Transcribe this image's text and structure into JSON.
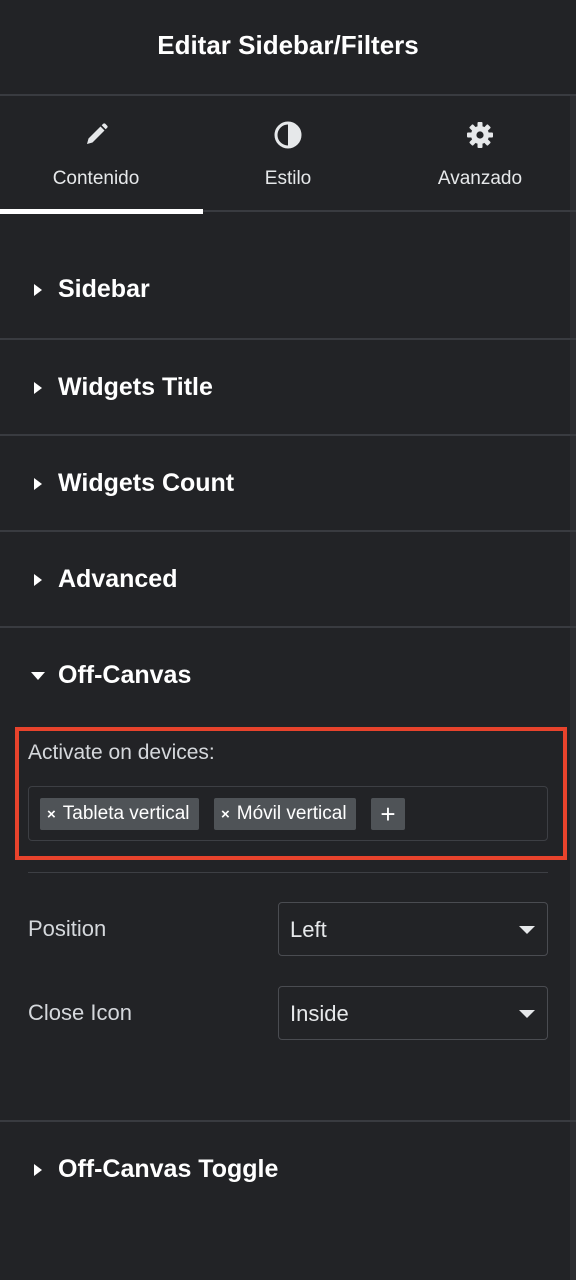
{
  "header": {
    "title": "Editar Sidebar/Filters"
  },
  "tabs": [
    {
      "label": "Contenido",
      "icon": "pencil-icon",
      "active": true
    },
    {
      "label": "Estilo",
      "icon": "contrast-icon",
      "active": false
    },
    {
      "label": "Avanzado",
      "icon": "gear-icon",
      "active": false
    }
  ],
  "sections": [
    {
      "title": "Sidebar",
      "expanded": false
    },
    {
      "title": "Widgets Title",
      "expanded": false
    },
    {
      "title": "Widgets Count",
      "expanded": false
    },
    {
      "title": "Advanced",
      "expanded": false
    },
    {
      "title": "Off-Canvas",
      "expanded": true
    },
    {
      "title": "Off-Canvas Toggle",
      "expanded": false
    }
  ],
  "off_canvas": {
    "devices_label": "Activate on devices:",
    "device_tags": [
      {
        "remove": "×",
        "label": "Tableta vertical"
      },
      {
        "remove": "×",
        "label": "Móvil vertical"
      }
    ],
    "add_label": "+",
    "position": {
      "label": "Position",
      "value": "Left"
    },
    "close_icon": {
      "label": "Close Icon",
      "value": "Inside"
    }
  },
  "colors": {
    "background": "#222326",
    "divider": "#393b40",
    "tag": "#4f5357",
    "highlight": "#e8432c"
  }
}
